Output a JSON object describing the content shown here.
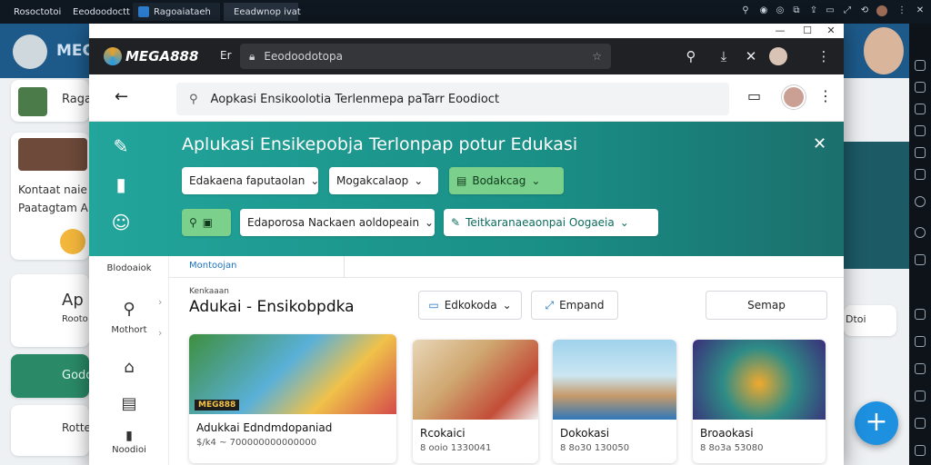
{
  "os_tabs": [
    {
      "label": "Rosoctotoi"
    },
    {
      "label": "Eeodoodoctt"
    },
    {
      "label": "Ragoaiataeh"
    },
    {
      "label": "Eeadwnop ivat"
    }
  ],
  "window": {
    "minimize": "—",
    "maximize": "☐",
    "close": "✕"
  },
  "toolbar": {
    "brand": "MEGA888",
    "tab_icon": "Er",
    "url": "Eeodoodotopa"
  },
  "search": {
    "value": "Aopkasi Ensikoolotia Terlenmepa paTarr Eoodioct"
  },
  "hero": {
    "title": "Aplukasi Ensikepobja Terlonpap potur Edukasi",
    "chips": [
      {
        "label": "Edakaena faputaolan"
      },
      {
        "label": "Mogakcalaop"
      },
      {
        "label": "Bodakcag"
      },
      {
        "label": "Edaporosa Nackaen aoldopeain"
      },
      {
        "label": "Teitkaranaeaonpai Oogaeia"
      }
    ]
  },
  "leftnav": {
    "header": "Blodoaiok",
    "items": [
      {
        "label": "Mothort"
      },
      {
        "label": ""
      },
      {
        "label": ""
      },
      {
        "label": "Noodioi"
      }
    ]
  },
  "filterbar": {
    "active": "Montoojan"
  },
  "section": {
    "caption": "Kenkaaan",
    "title": "Adukai - Ensikobpdka",
    "buttons": {
      "filter": "Edkokoda",
      "expand": "Empand",
      "sort": "Semap"
    }
  },
  "cards": [
    {
      "title": "Adukkai Edndmdopaniad",
      "meta": "$/k4  ~  700000000000000",
      "badge": "MEG888"
    },
    {
      "title": "Rcokaici",
      "meta": "8 ooio    1330041"
    },
    {
      "title": "Dokokasi",
      "meta": "8 8o30    130050"
    },
    {
      "title": "Broaokasi",
      "meta": "8  8o3a    53080"
    }
  ],
  "bg": {
    "brand": "MEG",
    "left_texts": [
      "Raga",
      "Kontaat naie",
      "Paatagtam A",
      "Ap",
      "Rooto",
      "Godo",
      "Rotte"
    ],
    "right_text": "Dtoi"
  },
  "colors": {
    "hero": "#1f9a90",
    "chip_green": "#7bd08c",
    "fab": "#1e90e0",
    "toolbar": "#202124"
  },
  "icons": [
    "back-arrow-icon",
    "search-icon",
    "folder-icon",
    "more-icon",
    "close-icon",
    "plus-icon",
    "star-icon",
    "download-icon",
    "lock-icon"
  ]
}
